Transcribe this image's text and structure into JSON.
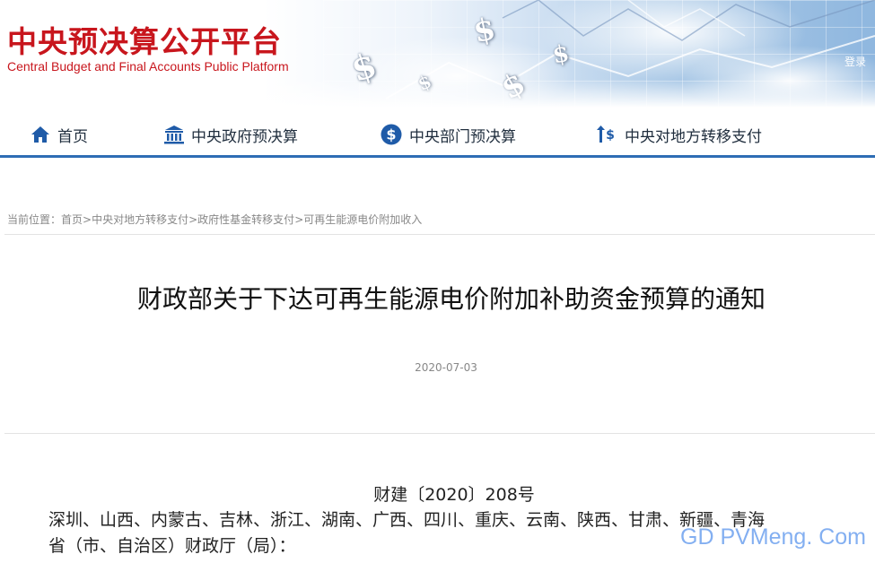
{
  "header": {
    "logo_cn": "中央预决算公开平台",
    "logo_en": "Central Budget and Final Accounts Public Platform",
    "login_link": "登录"
  },
  "nav": {
    "items": [
      {
        "label": "首页",
        "icon": "home-icon"
      },
      {
        "label": "中央政府预决算",
        "icon": "government-building-icon"
      },
      {
        "label": "中央部门预决算",
        "icon": "dollar-circle-icon"
      },
      {
        "label": "中央对地方转移支付",
        "icon": "transfer-arrows-icon"
      }
    ]
  },
  "breadcrumb": {
    "prefix": "当前位置：",
    "items": [
      "首页",
      "中央对地方转移支付",
      "政府性基金转移支付",
      "可再生能源电价附加收入"
    ],
    "separator": ">"
  },
  "article": {
    "title": "财政部关于下达可再生能源电价附加补助资金预算的通知",
    "date": "2020-07-03",
    "doc_number": "财建〔2020〕208号",
    "body_line1": "深圳、山西、内蒙古、吉林、浙江、湖南、广西、四川、重庆、云南、陕西、甘肃、新疆、青海",
    "body_line2": "省（市、自治区）财政厅（局）："
  },
  "watermark": "GD PVMeng. Com",
  "colors": {
    "brand_red": "#c8161d",
    "nav_blue": "#2e6db4",
    "icon_blue": "#1f5ba8"
  }
}
